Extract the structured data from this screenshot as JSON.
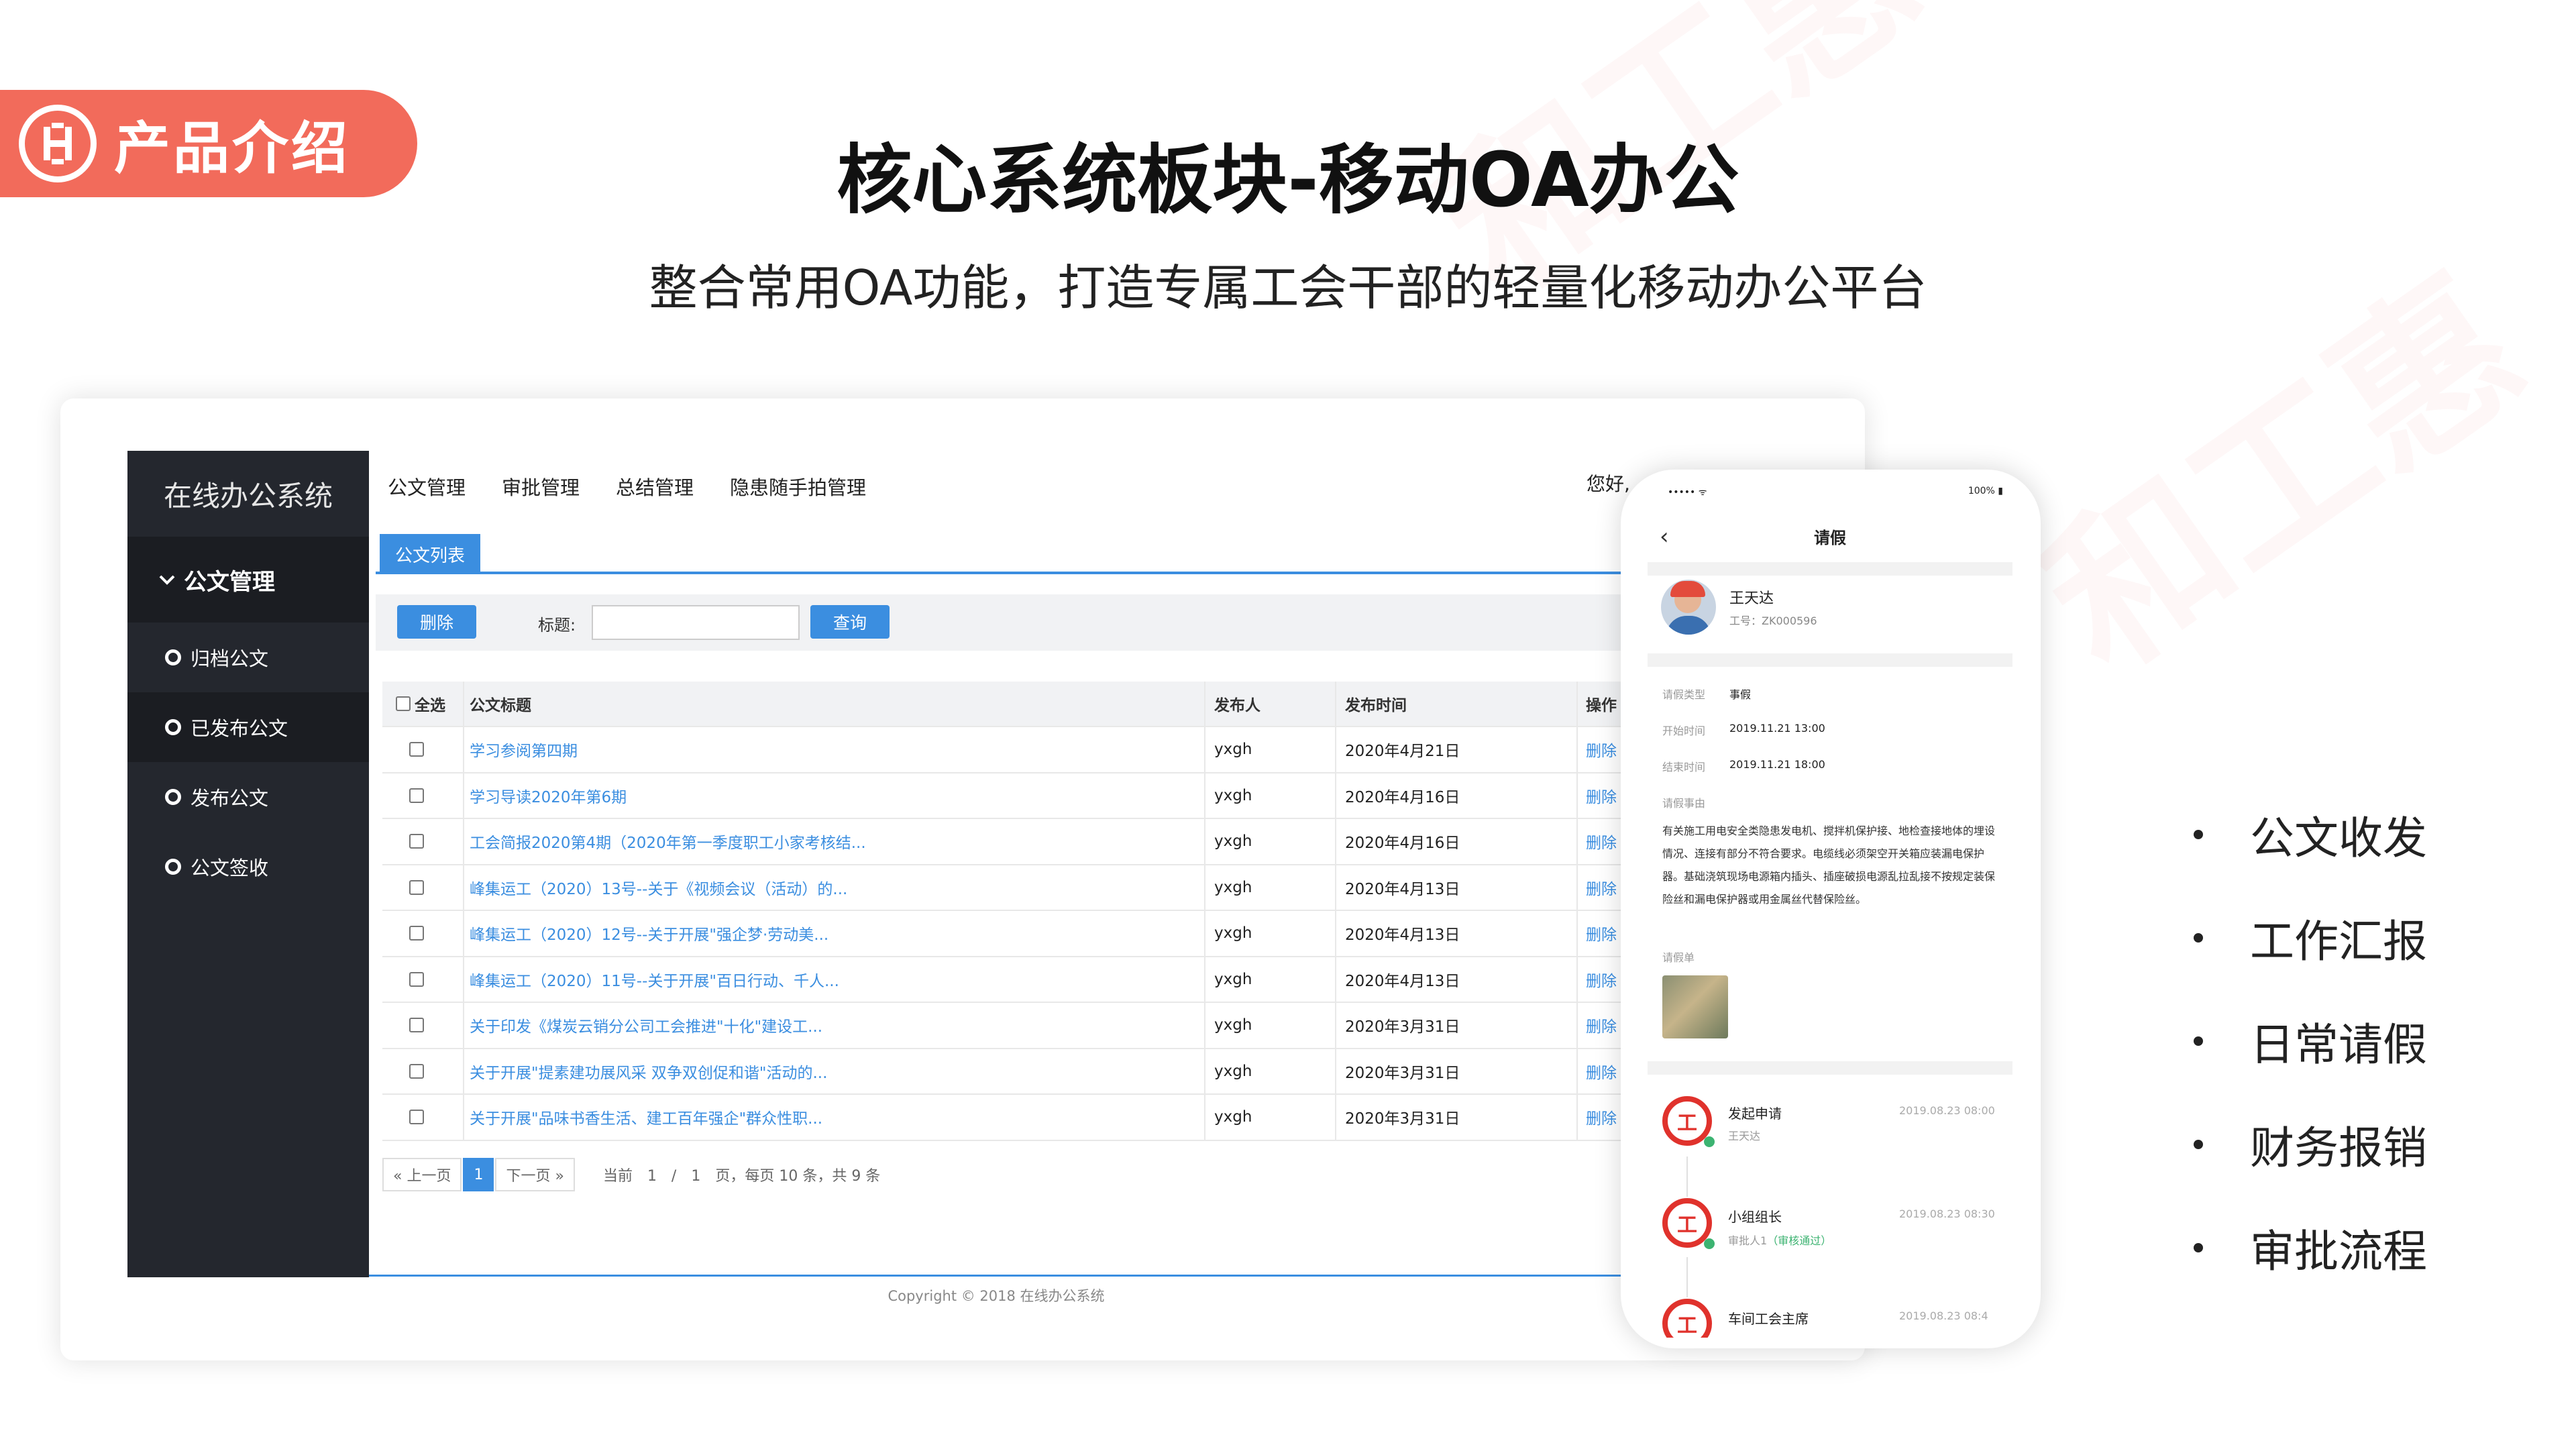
{
  "badge": {
    "label": "产品介绍"
  },
  "header": {
    "title": "核心系统板块-移动OA办公",
    "subtitle": "整合常用OA功能，打造专属工会干部的轻量化移动办公平台"
  },
  "watermark": {
    "text": "和工惠"
  },
  "desktop": {
    "brand": "在线办公系统",
    "sidebar": {
      "group_label": "公文管理",
      "items": [
        {
          "label": "归档公文"
        },
        {
          "label": "已发布公文"
        },
        {
          "label": "发布公文"
        },
        {
          "label": "公文签收"
        }
      ]
    },
    "nav": [
      {
        "label": "公文管理"
      },
      {
        "label": "审批管理"
      },
      {
        "label": "总结管理"
      },
      {
        "label": "隐患随手拍管理"
      }
    ],
    "greeting": "您好, ",
    "tab": {
      "label": "公文列表"
    },
    "toolbar": {
      "delete_label": "删除",
      "title_label": "标题:",
      "title_value": "",
      "query_label": "查询"
    },
    "table": {
      "headers": {
        "select_all": "全选",
        "title": "公文标题",
        "publisher": "发布人",
        "time": "发布时间",
        "action": "操作"
      },
      "rows": [
        {
          "title": "学习参阅第四期",
          "publisher": "yxgh",
          "time": "2020年4月21日",
          "action": "删除"
        },
        {
          "title": "学习导读2020年第6期",
          "publisher": "yxgh",
          "time": "2020年4月16日",
          "action": "删除"
        },
        {
          "title": "工会简报2020第4期（2020年第一季度职工小家考核结...",
          "publisher": "yxgh",
          "time": "2020年4月16日",
          "action": "删除"
        },
        {
          "title": "峰集运工（2020）13号--关于《视频会议（活动）的...",
          "publisher": "yxgh",
          "time": "2020年4月13日",
          "action": "删除"
        },
        {
          "title": "峰集运工（2020）12号--关于开展\"强企梦·劳动美...",
          "publisher": "yxgh",
          "time": "2020年4月13日",
          "action": "删除"
        },
        {
          "title": "峰集运工（2020）11号--关于开展\"百日行动、千人...",
          "publisher": "yxgh",
          "time": "2020年4月13日",
          "action": "删除"
        },
        {
          "title": "关于印发《煤炭云销分公司工会推进\"十化\"建设工...",
          "publisher": "yxgh",
          "time": "2020年3月31日",
          "action": "删除"
        },
        {
          "title": "关于开展\"提素建功展风采 双争双创促和谐\"活动的...",
          "publisher": "yxgh",
          "time": "2020年3月31日",
          "action": "删除"
        },
        {
          "title": "关于开展\"品味书香生活、建工百年强企\"群众性职...",
          "publisher": "yxgh",
          "time": "2020年3月31日",
          "action": "删除"
        }
      ]
    },
    "pager": {
      "prev": "« 上一页",
      "current": "1",
      "next": "下一页 »",
      "info": "当前　1　/　1　页，每页 10 条，共 9 条"
    },
    "copyright": "Copyright © 2018 在线办公系统"
  },
  "phone": {
    "status_left": "••••• ᯤ",
    "status_right": "100% ▮",
    "header_title": "请假",
    "back": "‹",
    "user": {
      "name": "王天达",
      "emp_no": "工号：ZK000596"
    },
    "fields": [
      {
        "label": "请假类型",
        "value": "事假"
      },
      {
        "label": "开始时间",
        "value": "2019.11.21  13:00"
      },
      {
        "label": "结束时间",
        "value": "2019.11.21  18:00"
      }
    ],
    "reason_label": "请假事由",
    "reason": "有关施工用电安全类隐患发电机、搅拌机保护接、地检查接地体的埋设情况、连接有部分不符合要求。电缆线必须架空开关箱应装漏电保护器。基础浇筑现场电源箱内插头、插座破损电源乱拉乱接不按规定装保险丝和漏电保护器或用金属丝代替保险丝。",
    "sheet_label": "请假单",
    "flow": [
      {
        "title": "发起申请",
        "sub": "王天达",
        "status": "",
        "time": "2019.08.23  08:00"
      },
      {
        "title": "小组组长",
        "sub": "审批人1",
        "status": "（审核通过）",
        "time": "2019.08.23  08:30"
      },
      {
        "title": "车间工会主席",
        "sub": "",
        "status": "",
        "time": "2019.08.23  08:4"
      }
    ]
  },
  "features": [
    {
      "label": "公文收发"
    },
    {
      "label": "工作汇报"
    },
    {
      "label": "日常请假"
    },
    {
      "label": "财务报销"
    },
    {
      "label": "审批流程"
    }
  ],
  "colors": {
    "accent": "#f26b5b",
    "primary_blue": "#3b8ee0",
    "sidebar": "#24272e",
    "union_red": "#e0322c"
  }
}
